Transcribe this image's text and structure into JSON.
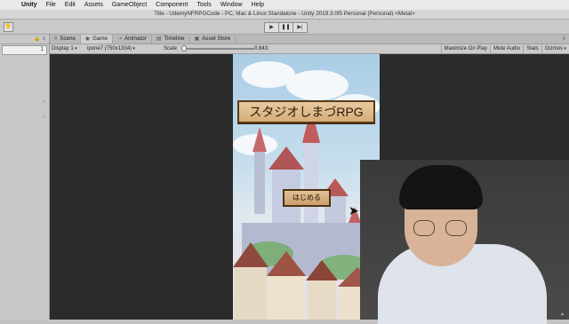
{
  "menubar": {
    "apple_icon": "apple-icon",
    "items": [
      "Unity",
      "File",
      "Edit",
      "Assets",
      "GameObject",
      "Component",
      "Tools",
      "Window",
      "Help"
    ]
  },
  "window_title": "Title - UdemyNFRPGCode - PC, Mac & Linux Standalone - Unity 2019.3.0f5 Personal (Personal) <Metal>",
  "toolbar": {
    "play_icon": "play-icon",
    "pause_icon": "pause-icon",
    "step_icon": "step-icon"
  },
  "left_panel": {
    "search_value": "1"
  },
  "tabs": [
    {
      "label": "Scene",
      "icon": "scene-icon"
    },
    {
      "label": "Game",
      "icon": "game-icon"
    },
    {
      "label": "Animator",
      "icon": "animator-icon"
    },
    {
      "label": "Timeline",
      "icon": "timeline-icon"
    },
    {
      "label": "Asset Store",
      "icon": "asset-store-icon"
    }
  ],
  "game_bar": {
    "display": "Display 1",
    "resolution": "ipone7 (750x1334)",
    "scale_label": "Scale",
    "scale_value": "0.843:",
    "scale_fraction": 0.0,
    "buttons": [
      "Maximize On Play",
      "Mute Audio",
      "Stats",
      "Gizmos"
    ]
  },
  "game": {
    "title": "スタジオしまづRPG",
    "start_button": "はじめる"
  }
}
